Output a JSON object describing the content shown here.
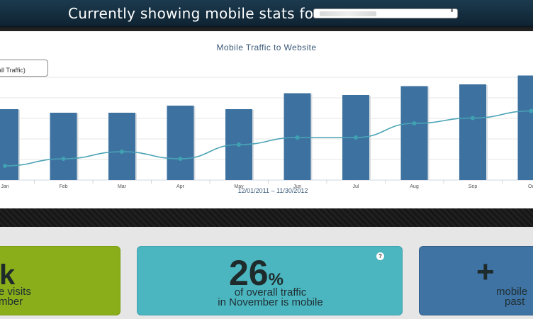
{
  "header": {
    "title": "Currently showing mobile stats for",
    "site_selector_arrows": "⬍"
  },
  "chart": {
    "legend_label": "erall Traffic)"
  },
  "chart_data": {
    "type": "bar",
    "title": "Mobile Traffic to Website",
    "xlabel": "12/01/2011 – 11/30/2012",
    "categories": [
      "Jan",
      "Feb",
      "Mar",
      "Apr",
      "May",
      "Jun",
      "Jul",
      "Aug",
      "Sep",
      "Oct"
    ],
    "tick_labels": [
      "Jan",
      "Feb",
      "Mar",
      "Apr",
      "May",
      "Jun",
      "Jul",
      "Aug",
      "Sep",
      "Oc"
    ],
    "series": [
      {
        "type": "bar",
        "values": [
          40,
          38,
          38,
          42,
          40,
          49,
          48,
          53,
          54,
          59
        ]
      },
      {
        "type": "line",
        "values": [
          8,
          12,
          16,
          12,
          20,
          24,
          24,
          32,
          35,
          39
        ]
      }
    ],
    "ylim": [
      0,
      70
    ],
    "grid": true,
    "colors": {
      "bar": "#3d72a0",
      "line": "#4aa3b5",
      "point": "#3fa1b2"
    }
  },
  "cards": {
    "green": {
      "number": "k",
      "line1": "e visits",
      "line2": "mber"
    },
    "teal": {
      "number": "26",
      "suffix": "%",
      "line1": "of overall traffic",
      "line2": "in November is mobile",
      "help": "?"
    },
    "blue": {
      "number": "+",
      "line1": "mobile",
      "line2": "past"
    }
  },
  "colors": {
    "header_bg": "#17323f",
    "card_green": "#8aae1a",
    "card_teal": "#4bb5c0",
    "card_blue": "#3f73a4"
  }
}
